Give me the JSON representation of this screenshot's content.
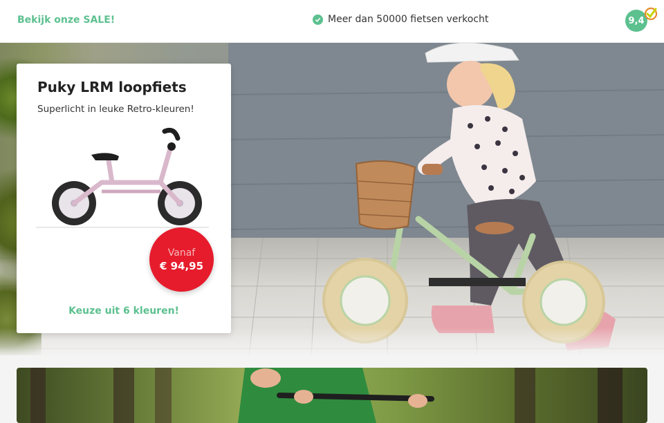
{
  "header": {
    "sale_link": "Bekijk onze SALE!",
    "usp_text": "Meer dan 50000 fietsen verkocht",
    "rating": "9,4"
  },
  "hero": {
    "product_title": "Puky LRM loopfiets",
    "product_subtitle": "Superlicht in leuke Retro-kleuren!",
    "price_from": "Vanaf",
    "price_value": "€ 94,95",
    "colors_link": "Keuze uit 6 kleuren!"
  },
  "colors": {
    "accent": "#5cc08f",
    "price": "#e61c2c",
    "bike_pink": "#d9b8cc"
  }
}
